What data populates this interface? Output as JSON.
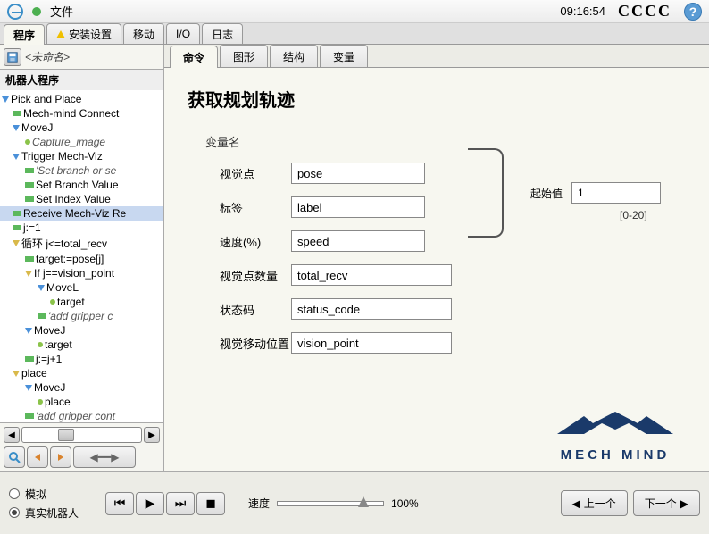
{
  "titlebar": {
    "title": "文件",
    "clock": "09:16:54",
    "status": "CCCC"
  },
  "mainTabs": [
    "程序",
    "安装设置",
    "移动",
    "I/O",
    "日志"
  ],
  "fileName": "<未命名>",
  "treeTitle": "机器人程序",
  "tree": [
    {
      "t": "Pick and Place",
      "i": 0,
      "k": "tri"
    },
    {
      "t": "Mech-mind Connect",
      "i": 1,
      "k": "bar"
    },
    {
      "t": "MoveJ",
      "i": 1,
      "k": "tri"
    },
    {
      "t": "Capture_image",
      "i": 2,
      "k": "dot",
      "it": true
    },
    {
      "t": "Trigger Mech-Viz",
      "i": 1,
      "k": "tri"
    },
    {
      "t": "'Set branch or se",
      "i": 2,
      "k": "bar",
      "it": true
    },
    {
      "t": "Set Branch Value",
      "i": 2,
      "k": "bar"
    },
    {
      "t": "Set Index Value",
      "i": 2,
      "k": "bar"
    },
    {
      "t": "Receive Mech-Viz Re",
      "i": 1,
      "k": "bar",
      "sel": true
    },
    {
      "t": "j:=1",
      "i": 1,
      "k": "bar"
    },
    {
      "t": "循环 j<=total_recv",
      "i": 1,
      "k": "triy"
    },
    {
      "t": "target:=pose[j]",
      "i": 2,
      "k": "bar"
    },
    {
      "t": "If j==vision_point",
      "i": 2,
      "k": "triy"
    },
    {
      "t": "MoveL",
      "i": 3,
      "k": "tri"
    },
    {
      "t": "target",
      "i": 4,
      "k": "dot"
    },
    {
      "t": "'add gripper c",
      "i": 3,
      "k": "bar",
      "it": true
    },
    {
      "t": "MoveJ",
      "i": 2,
      "k": "tri"
    },
    {
      "t": "target",
      "i": 3,
      "k": "dot"
    },
    {
      "t": "j:=j+1",
      "i": 2,
      "k": "bar"
    },
    {
      "t": "place",
      "i": 1,
      "k": "triy"
    },
    {
      "t": "MoveJ",
      "i": 2,
      "k": "tri"
    },
    {
      "t": "place",
      "i": 3,
      "k": "dot"
    },
    {
      "t": "'add gripper cont",
      "i": 2,
      "k": "bar",
      "it": true
    }
  ],
  "subTabs": [
    "命令",
    "图形",
    "结构",
    "变量"
  ],
  "content": {
    "heading": "获取规划轨迹",
    "sectionLabel": "变量名",
    "fields": {
      "visionPoint": {
        "label": "视觉点",
        "value": "pose"
      },
      "tag": {
        "label": "标签",
        "value": "label"
      },
      "speed": {
        "label": "速度(%)",
        "value": "speed"
      },
      "count": {
        "label": "视觉点数量",
        "value": "total_recv"
      },
      "status": {
        "label": "状态码",
        "value": "status_code"
      },
      "movePos": {
        "label": "视觉移动位置",
        "value": "vision_point"
      }
    },
    "startValue": {
      "label": "起始值",
      "value": "1",
      "range": "[0-20]"
    }
  },
  "logo": "MECH MIND",
  "footer": {
    "sim": "模拟",
    "real": "真实机器人",
    "speedLabel": "速度",
    "speedValue": "100%",
    "prev": "上一个",
    "next": "下一个"
  }
}
